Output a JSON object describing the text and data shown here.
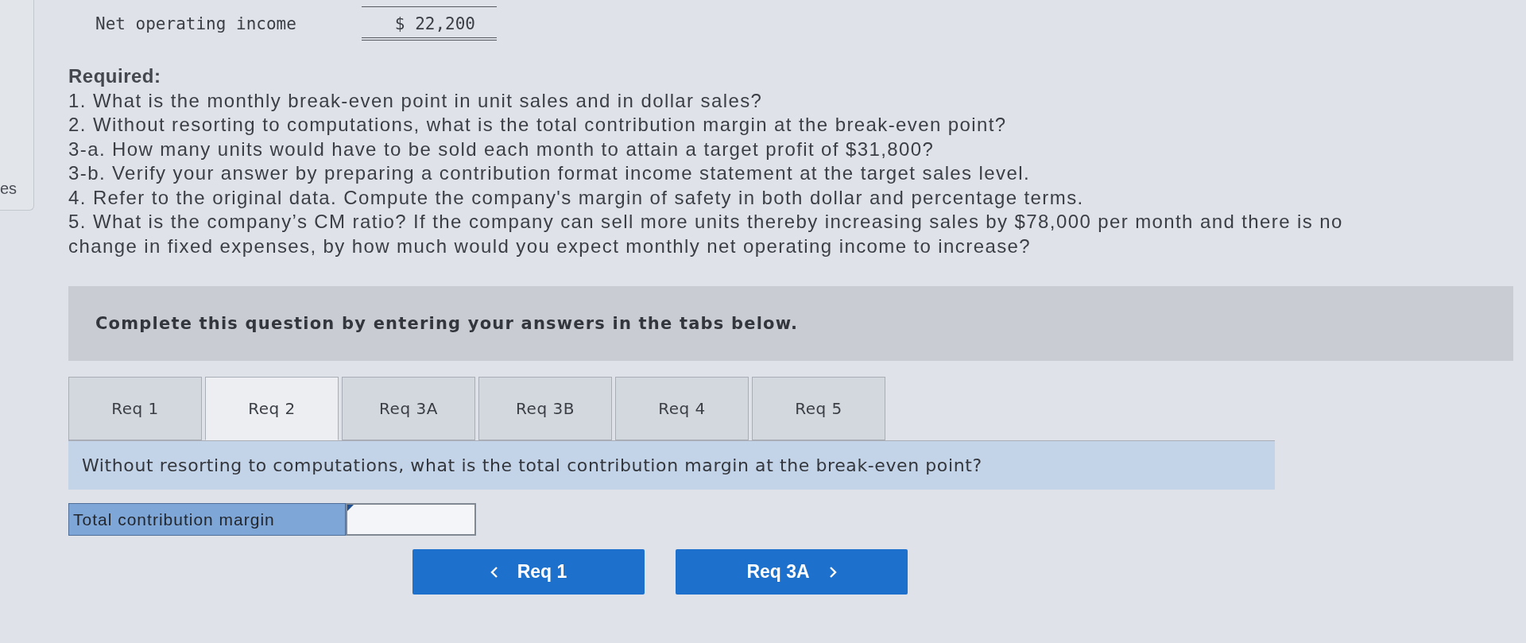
{
  "side_panel": {
    "text": "es"
  },
  "income_statement": {
    "rows": [
      {
        "label": "Net operating income",
        "value": "$ 22,200",
        "kind": "total"
      }
    ]
  },
  "required": {
    "heading": "Required:",
    "items": [
      "1. What is the monthly break-even point in unit sales and in dollar sales?",
      "2. Without resorting to computations, what is the total contribution margin at the break-even point?",
      "3-a. How many units would have to be sold each month to attain a target profit of $31,800?",
      "3-b. Verify your answer by preparing a contribution format income statement at the target sales level.",
      "4. Refer to the original data. Compute the company's margin of safety in both dollar and percentage terms.",
      "5. What is the company’s CM ratio? If the company can sell more units thereby increasing sales by $78,000 per month and there is no change in fixed expenses, by how much would you expect monthly net operating income to increase?"
    ]
  },
  "instructions": "Complete this question by entering your answers in the tabs below.",
  "tabs": [
    {
      "label": "Req 1",
      "selected": false
    },
    {
      "label": "Req 2",
      "selected": true
    },
    {
      "label": "Req 3A",
      "selected": false
    },
    {
      "label": "Req 3B",
      "selected": false
    },
    {
      "label": "Req 4",
      "selected": false
    },
    {
      "label": "Req 5",
      "selected": false
    }
  ],
  "question": "Without resorting to computations, what is the total contribution margin at the break-even point?",
  "answer": {
    "label": "Total contribution margin"
  },
  "nav_buttons": [
    {
      "label": "Req 1",
      "kind": "previous"
    },
    {
      "label": "Req 3A",
      "kind": "next"
    }
  ]
}
